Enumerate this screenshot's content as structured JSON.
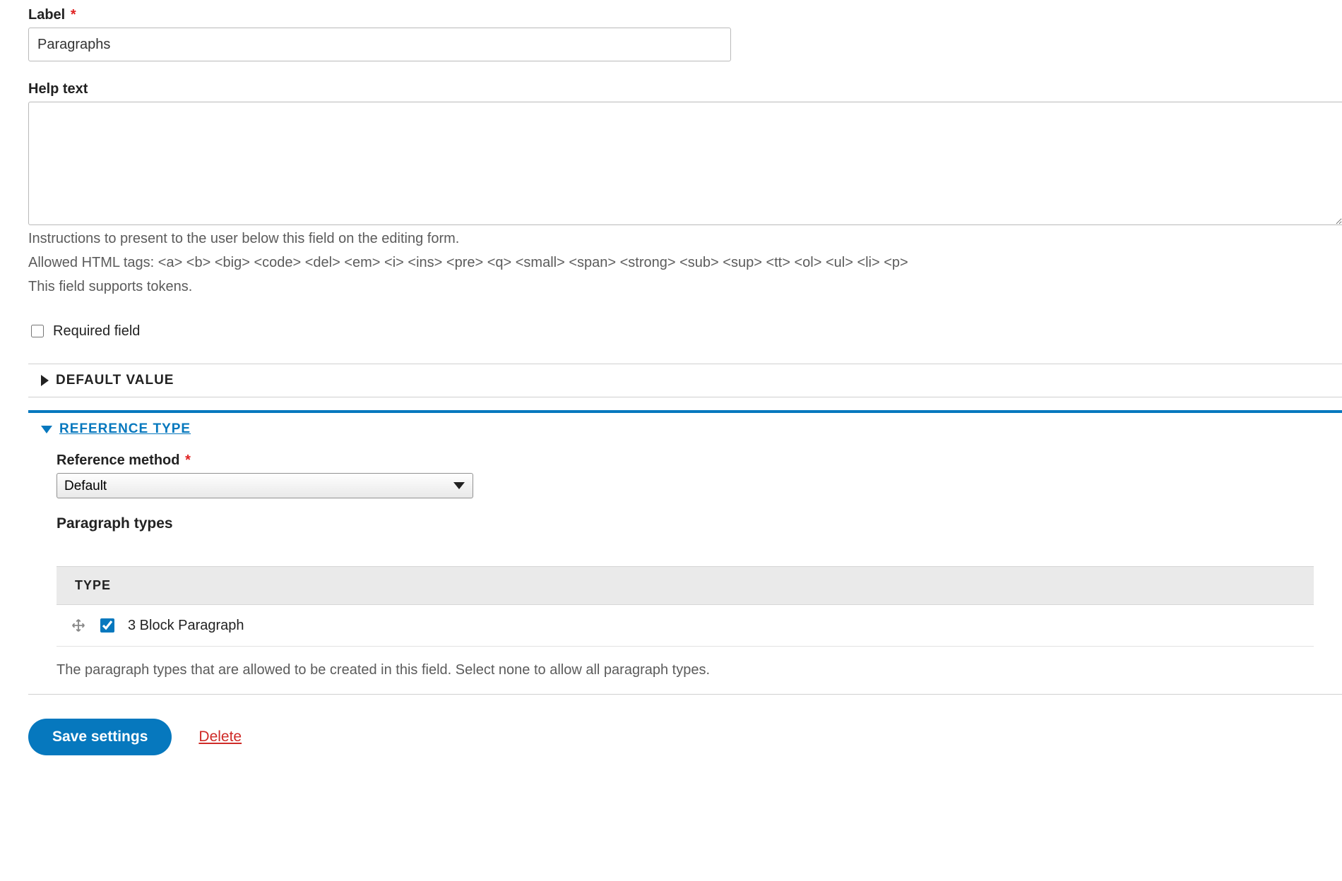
{
  "label_field": {
    "label": "Label",
    "required_mark": "*",
    "value": "Paragraphs"
  },
  "help_text": {
    "label": "Help text",
    "value": "",
    "desc1": "Instructions to present to the user below this field on the editing form.",
    "desc2": "Allowed HTML tags: <a> <b> <big> <code> <del> <em> <i> <ins> <pre> <q> <small> <span> <strong> <sub> <sup> <tt> <ol> <ul> <li> <p>",
    "desc3": "This field supports tokens."
  },
  "required_field": {
    "label": "Required field",
    "checked": false
  },
  "collapsible": {
    "default_value": "DEFAULT VALUE",
    "reference_type": "REFERENCE TYPE"
  },
  "reference": {
    "method_label": "Reference method",
    "method_required_mark": "*",
    "method_value": "Default",
    "paragraph_types_label": "Paragraph types",
    "table_header": "TYPE",
    "items": [
      {
        "label": "3 Block Paragraph",
        "checked": true
      }
    ],
    "types_description": "The paragraph types that are allowed to be created in this field. Select none to allow all paragraph types."
  },
  "actions": {
    "save": "Save settings",
    "delete": "Delete"
  }
}
